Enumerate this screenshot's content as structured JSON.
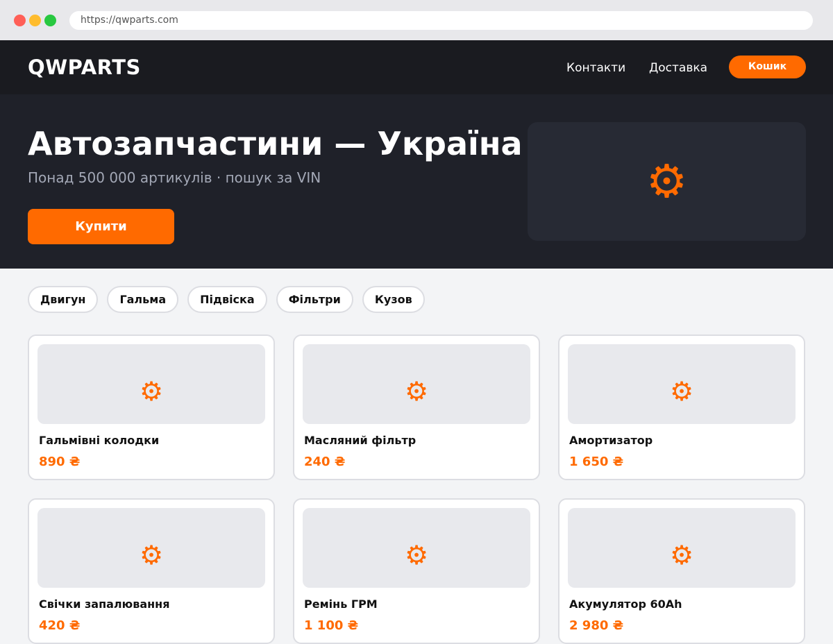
{
  "browser": {
    "url": "https://qwparts.com"
  },
  "header": {
    "logo": "QWPARTS",
    "nav": [
      "Контакти",
      "Доставка"
    ],
    "cart_label": "Кошик"
  },
  "hero": {
    "title": "Автозапчастини — Україна",
    "subtitle": "Понад 500 000 артикулів · пошук за VIN",
    "buy_label": "Купити",
    "image_icon": "gear-icon"
  },
  "categories": [
    "Двигун",
    "Гальма",
    "Підвіска",
    "Фільтри",
    "Кузов"
  ],
  "products": [
    {
      "name": "Гальмівні колодки",
      "price": "890 ₴",
      "icon": "gear-icon"
    },
    {
      "name": "Масляний фільтр",
      "price": "240 ₴",
      "icon": "gear-icon"
    },
    {
      "name": "Амортизатор",
      "price": "1 650 ₴",
      "icon": "gear-icon"
    },
    {
      "name": "Свічки запалювання",
      "price": "420 ₴",
      "icon": "gear-icon"
    },
    {
      "name": "Ремінь ГРМ",
      "price": "1 100 ₴",
      "icon": "gear-icon"
    },
    {
      "name": "Акумулятор 60Ah",
      "price": "2 980 ₴",
      "icon": "gear-icon"
    }
  ],
  "colors": {
    "accent": "#ff6a00",
    "header_bg": "#1a1b20",
    "hero_bg": "#1f2129"
  }
}
